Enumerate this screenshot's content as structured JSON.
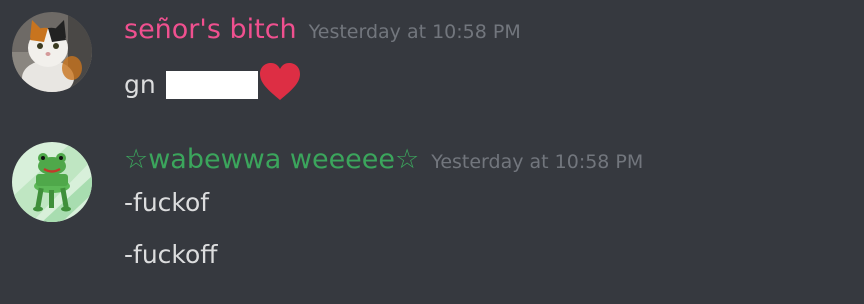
{
  "messages": [
    {
      "username": "señor's bitch",
      "username_color": "#f0508f",
      "timestamp": "Yesterday at 10:58 PM",
      "avatar_icon": "cat-avatar",
      "lines": [
        {
          "text": "gn",
          "redacted": true,
          "emoji": "heart-emoji"
        }
      ]
    },
    {
      "username": "☆wabewwa weeeee☆",
      "username_color": "#3ba55c",
      "timestamp": "Yesterday at 10:58 PM",
      "avatar_icon": "frog-chair-avatar",
      "lines": [
        {
          "text": "-fuckof"
        },
        {
          "text": "-fuckoff"
        }
      ]
    }
  ],
  "colors": {
    "background": "#36393f",
    "message_text": "#dcddde",
    "timestamp": "#72767d",
    "heart": "#dd2e44"
  }
}
